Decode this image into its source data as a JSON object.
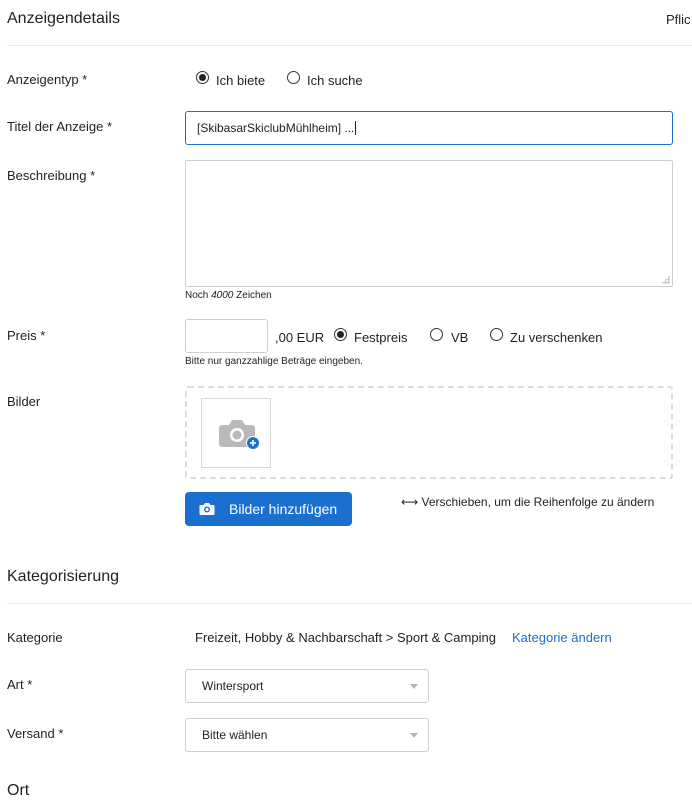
{
  "details": {
    "title": "Anzeigendetails",
    "required_note": "Pflic"
  },
  "ad_type": {
    "label": "Anzeigentyp *",
    "options": [
      "Ich biete",
      "Ich suche"
    ],
    "selected": "Ich biete"
  },
  "ad_title": {
    "label": "Titel der Anzeige *",
    "value": "[SkibasarSkiclubMühlheim] ..."
  },
  "description": {
    "label": "Beschreibung *",
    "value": "",
    "hint_prefix": "Noch ",
    "hint_count": "4000",
    "hint_suffix": " Zeichen"
  },
  "price": {
    "label": "Preis *",
    "value": "",
    "currency_suffix": ",00 EUR",
    "options": [
      "Festpreis",
      "VB",
      "Zu verschenken"
    ],
    "selected": "Festpreis",
    "hint": "Bitte nur ganzzahlige Beträge eingeben."
  },
  "images": {
    "label": "Bilder",
    "add_button_label": "Bilder hinzufügen",
    "reorder_hint": "⟷ Verschieben, um die Reihenfolge zu ändern"
  },
  "categorization": {
    "title": "Kategorisierung",
    "category_label": "Kategorie",
    "category_value": "Freizeit, Hobby & Nachbarschaft > Sport & Camping",
    "change_link": "Kategorie ändern",
    "type_label": "Art *",
    "type_value": "Wintersport",
    "shipping_label": "Versand *",
    "shipping_value": "Bitte wählen"
  },
  "location": {
    "title": "Ort"
  },
  "colors": {
    "accent": "#1b6fce",
    "border": "#cfcfcf",
    "divider": "#e6e6e6"
  }
}
